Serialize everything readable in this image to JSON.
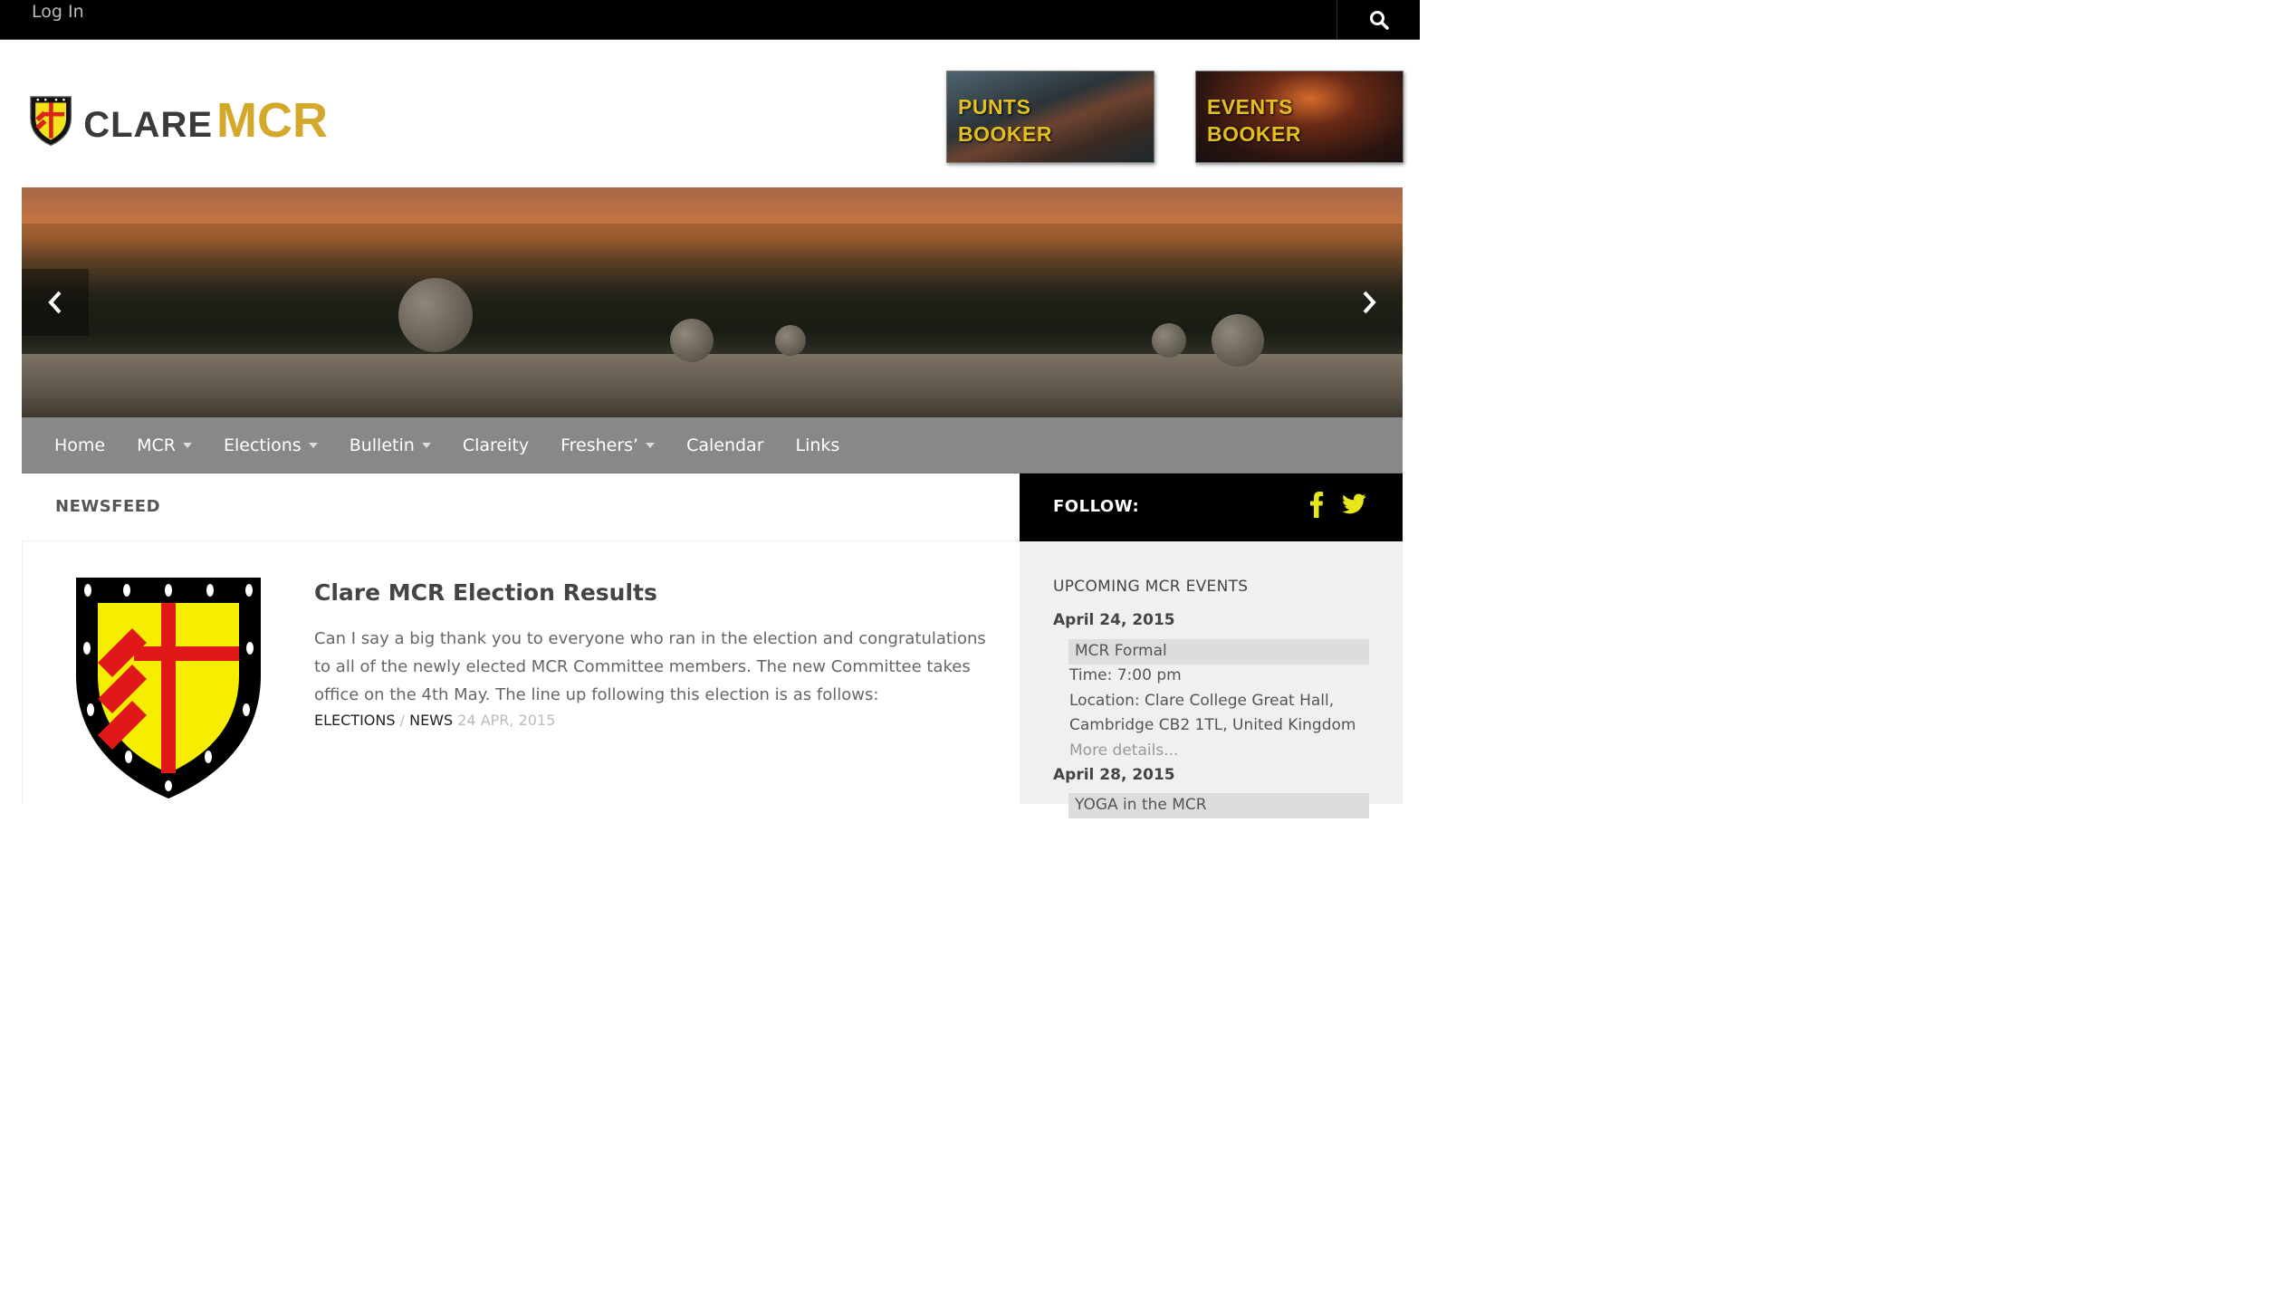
{
  "topbar": {
    "login_label": "Log In"
  },
  "brand": {
    "name_part1": "CLARE",
    "name_part2": "MCR"
  },
  "bookers": [
    {
      "line1": "PUNTS",
      "line2": "BOOKER"
    },
    {
      "line1": "EVENTS",
      "line2": "BOOKER"
    }
  ],
  "nav": {
    "items": [
      {
        "label": "Home"
      },
      {
        "label": "MCR"
      },
      {
        "label": "Elections"
      },
      {
        "label": "Bulletin"
      },
      {
        "label": "Clareity"
      },
      {
        "label": "Freshers’"
      },
      {
        "label": "Calendar"
      },
      {
        "label": "Links"
      }
    ]
  },
  "main": {
    "heading": "NEWSFEED",
    "post": {
      "title": "Clare MCR Election Results",
      "excerpt": "Can I say a big thank you to everyone who ran in the election and congratulations to all of the newly elected MCR Committee members. The new Committee takes office on the 4th May. The line up following this election is as follows:",
      "categories": [
        "ELECTIONS",
        "NEWS"
      ],
      "category_separator": "/",
      "date": "24 APR, 2015"
    }
  },
  "sidebar": {
    "follow_label": "FOLLOW:",
    "events_title": "UPCOMING MCR EVENTS",
    "events": [
      {
        "date": "April 24, 2015",
        "name": "MCR Formal",
        "time": "Time: 7:00 pm",
        "location_line1": "Location: Clare College Great Hall,",
        "location_line2": "Cambridge CB2 1TL, United Kingdom",
        "more": "More details..."
      },
      {
        "date": "April 28, 2015",
        "name": "YOGA in the MCR"
      }
    ]
  },
  "colors": {
    "accent_gold": "#d4a82a",
    "social_yellow": "#e6e619",
    "nav_bg": "#888888",
    "topbar_bg": "#000000"
  },
  "icons": [
    "search-icon",
    "shield-logo-icon",
    "chevron-left-icon",
    "chevron-right-icon",
    "caret-down-icon",
    "facebook-icon",
    "twitter-icon"
  ]
}
